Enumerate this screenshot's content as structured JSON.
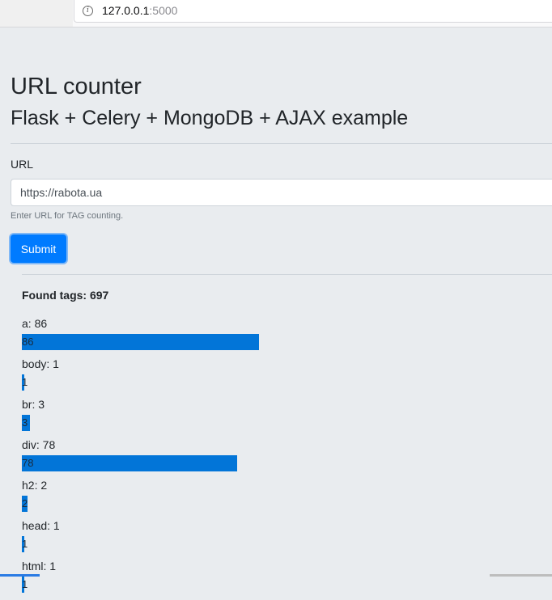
{
  "browser": {
    "url_host": "127.0.0.1",
    "url_port": ":5000"
  },
  "page": {
    "title": "URL counter",
    "subtitle": "Flask + Celery + MongoDB + AJAX example"
  },
  "form": {
    "label": "URL",
    "value": "https://rabota.ua",
    "help": "Enter URL for TAG counting.",
    "submit_label": "Submit"
  },
  "results": {
    "found_label": "Found tags: 697",
    "max_value": 86,
    "tags": [
      {
        "label": "a: 86",
        "value": 86,
        "value_text": "86"
      },
      {
        "label": "body: 1",
        "value": 1,
        "value_text": "1"
      },
      {
        "label": "br: 3",
        "value": 3,
        "value_text": "3"
      },
      {
        "label": "div: 78",
        "value": 78,
        "value_text": "78"
      },
      {
        "label": "h2: 2",
        "value": 2,
        "value_text": "2"
      },
      {
        "label": "head: 1",
        "value": 1,
        "value_text": "1"
      },
      {
        "label": "html: 1",
        "value": 1,
        "value_text": "1"
      }
    ]
  },
  "colors": {
    "bar": "#0275d8",
    "button": "#007bff",
    "background": "#e9ecef"
  },
  "icons": {
    "address_info": "info-icon"
  }
}
